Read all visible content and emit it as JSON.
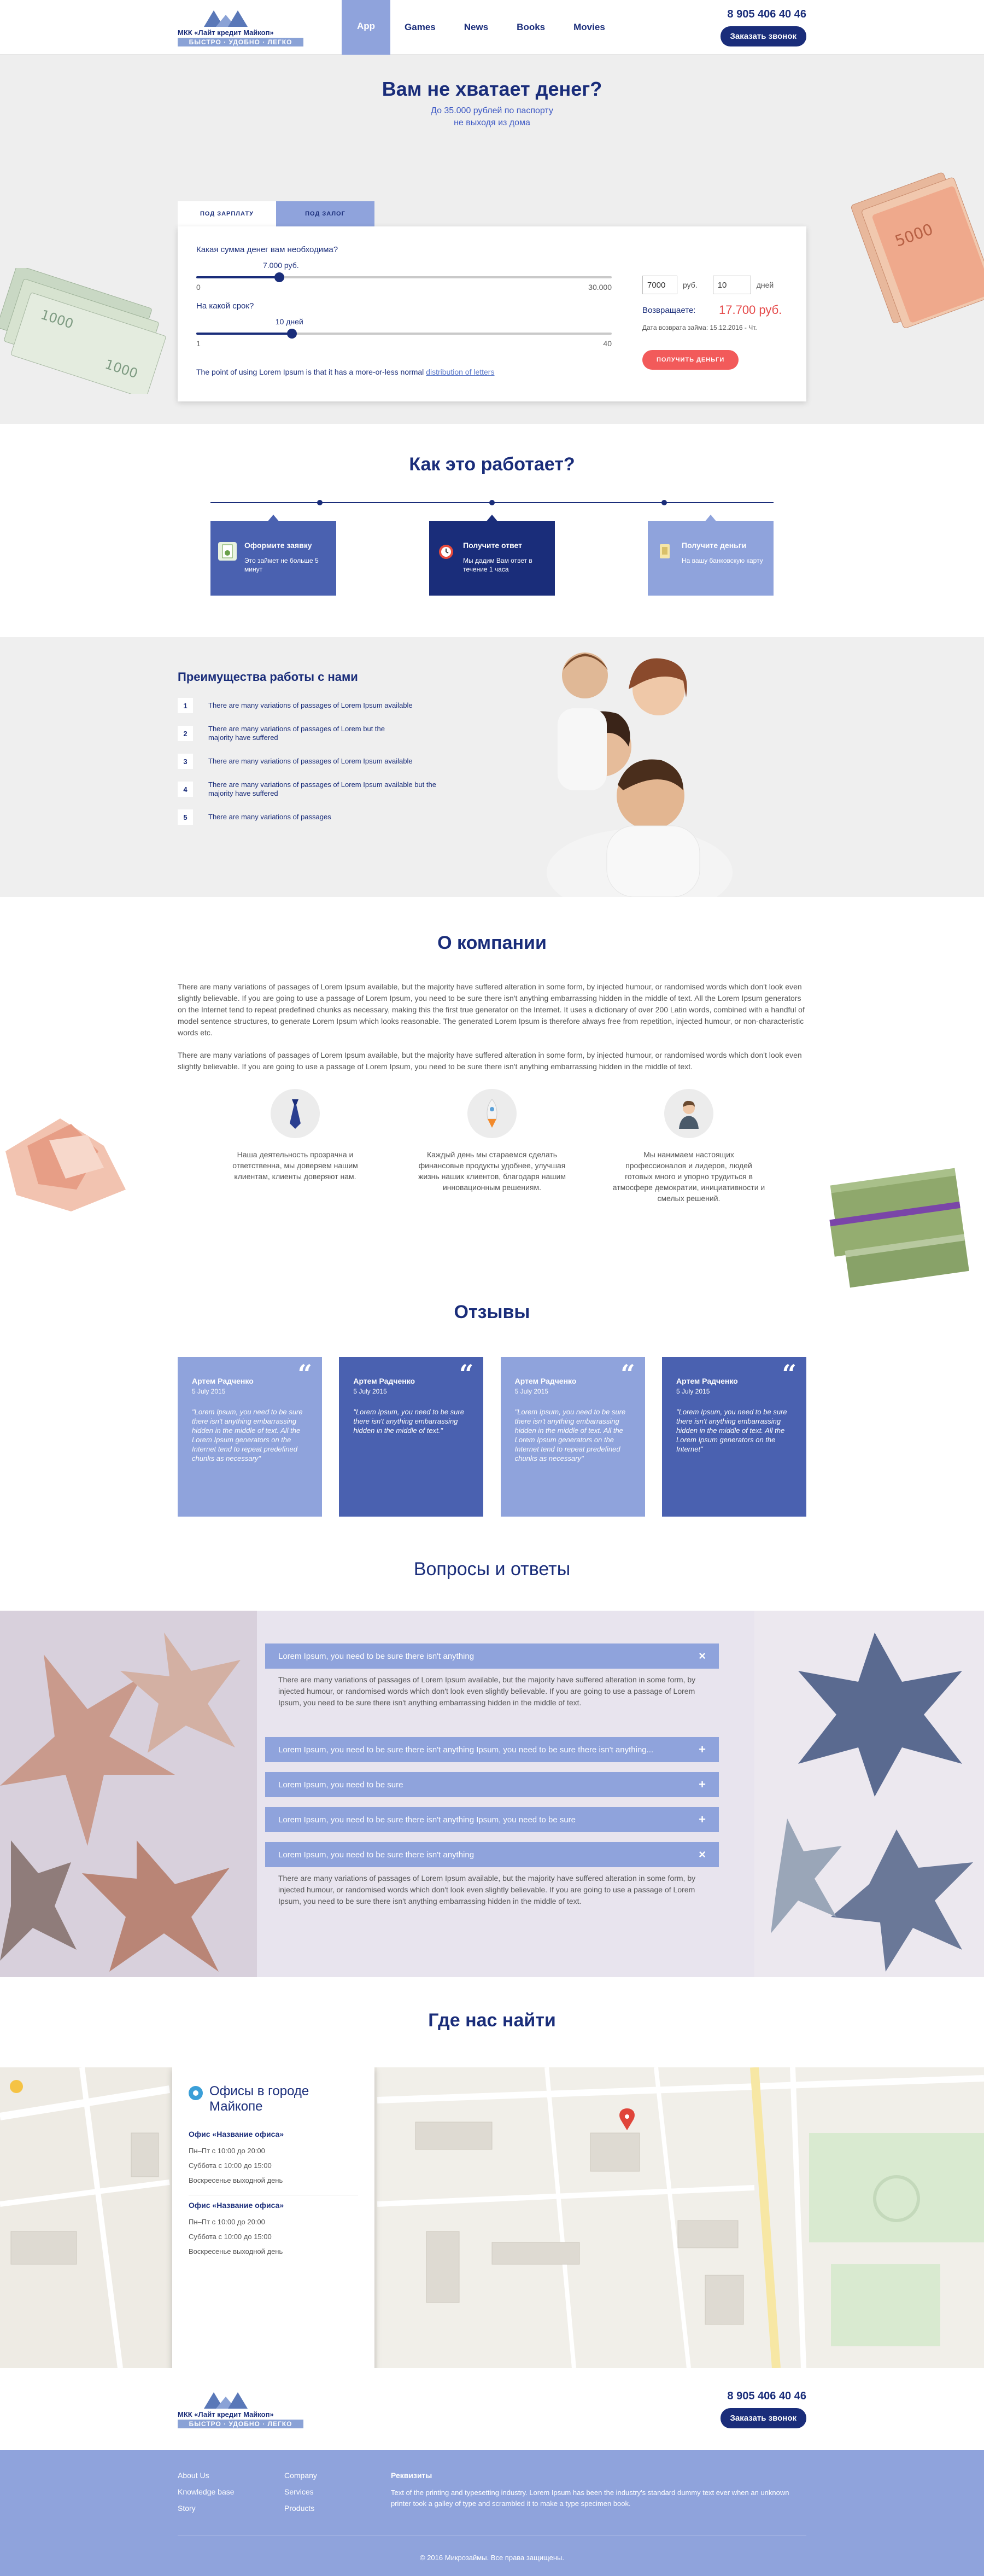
{
  "header": {
    "logo_name": "МКК «Лайт кредит Майкоп»",
    "logo_slogan": "БЫСТРО · УДОБНО · ЛЕГКО",
    "nav": [
      "App",
      "Games",
      "News",
      "Books",
      "Movies"
    ],
    "active_nav": "App",
    "phone": "8 905 406 40 46",
    "callback_button": "Заказать звонок"
  },
  "hero": {
    "title": "Вам не хватает денег?",
    "subtitle_1": "До 35.000 рублей по паспорту",
    "subtitle_2": "не выходя из дома",
    "tabs": [
      "ПОД ЗАРПЛАТУ",
      "ПОД ЗАЛОГ"
    ],
    "amount_question": "Какая сумма денег вам необходима?",
    "amount_value": "7.000 руб.",
    "amount_fraction": 0.2,
    "amount_min": "0",
    "amount_max": "30.000",
    "term_question": "На какой срок?",
    "term_value": "10 дней",
    "term_fraction": 0.23,
    "term_min": "1",
    "term_max": "40",
    "note_text": "The point of using Lorem Ipsum is that it has a more-or-less normal",
    "note_link": "distribution of letters",
    "amount_input": "7000",
    "amount_unit": "руб.",
    "term_input": "10",
    "term_unit": "дней",
    "return_label": "Возвращаете:",
    "return_value": "17.700 руб.",
    "return_date": "Дата возврата займа: 15.12.2016 - Чт.",
    "get_money_button": "ПОЛУЧИТЬ ДЕНЬГИ"
  },
  "how": {
    "title": "Как это работает?",
    "steps": [
      {
        "title": "Оформите заявку",
        "text": "Это займет не больше 5 минут"
      },
      {
        "title": "Получите ответ",
        "text": "Мы дадим Вам ответ в течение 1 часа"
      },
      {
        "title": "Получите деньги",
        "text": "На вашу банковскую карту"
      }
    ]
  },
  "advantages": {
    "title": "Преимущества работы с нами",
    "items": [
      {
        "num": "1",
        "text": "There are many variations of passages of Lorem Ipsum available"
      },
      {
        "num": "2",
        "text": "There are many variations of passages of Lorem but the majority have suffered"
      },
      {
        "num": "3",
        "text": "There are many variations of passages of Lorem Ipsum available"
      },
      {
        "num": "4",
        "text": "There are many variations of passages of Lorem Ipsum available but the majority have suffered"
      },
      {
        "num": "5",
        "text": "There are many variations of passages"
      }
    ]
  },
  "about": {
    "title": "О компании",
    "p1": "There are many variations of passages of Lorem Ipsum available, but the majority have suffered alteration in some form, by injected humour, or randomised words which don't look even slightly believable. If you are going to use a passage of Lorem Ipsum, you need to be sure there isn't anything embarrassing hidden in the middle of text. All the Lorem Ipsum generators on the Internet tend to repeat predefined chunks as necessary, making this the first true generator on the Internet. It uses a dictionary of over 200 Latin words, combined with a handful of model sentence structures, to generate Lorem Ipsum which looks reasonable. The generated Lorem Ipsum is therefore always free from repetition, injected humour, or non-characteristic words etc.",
    "p2": "There are many variations of passages of Lorem Ipsum available, but the majority have suffered alteration in some form, by injected humour, or randomised words which don't look even slightly believable. If you are going to use a passage of Lorem Ipsum, you need to be sure there isn't anything embarrassing hidden in the middle of text.",
    "features": [
      {
        "icon": "tie-icon",
        "text": "Наша деятельность прозрачна и ответственна, мы доверяем нашим клиентам, клиенты доверяют нам."
      },
      {
        "icon": "rocket-icon",
        "text": "Каждый день мы стараемся сделать финансовые продукты удобнее, улучшая жизнь наших клиентов, благодаря нашим инновационным решениям."
      },
      {
        "icon": "person-icon",
        "text": "Мы нанимаем настоящих профессионалов и лидеров, людей готовых много и упорно трудиться в атмосфере демократии, инициативности и смелых решений."
      }
    ]
  },
  "reviews": {
    "title": "Отзывы",
    "items": [
      {
        "name": "Артем Радченко",
        "date": "5 July 2015",
        "text": "\"Lorem Ipsum, you need to be sure there isn't anything embarrassing hidden in the middle of text. All the Lorem Ipsum generators on the Internet tend to repeat predefined chunks as necessary\""
      },
      {
        "name": "Артем Радченко",
        "date": "5 July 2015",
        "text": "\"Lorem Ipsum, you need to be sure there isn't anything embarrassing hidden in the middle of text.\""
      },
      {
        "name": "Артем Радченко",
        "date": "5 July 2015",
        "text": "\"Lorem Ipsum, you need to be sure there isn't anything embarrassing hidden in the middle of text. All the Lorem Ipsum generators on the Internet tend to repeat predefined chunks as necessary\""
      },
      {
        "name": "Артем Радченко",
        "date": "5 July 2015",
        "text": "\"Lorem Ipsum, you need to be sure there isn't anything embarrassing hidden in the middle of text. All the Lorem Ipsum generators on the Internet\""
      }
    ]
  },
  "faq": {
    "title": "Вопросы и ответы",
    "items": [
      {
        "q": "Lorem Ipsum, you need to be sure there isn't anything",
        "sign": "×",
        "a": "There are many variations of passages of Lorem Ipsum available, but the majority have suffered alteration in some form, by injected humour, or randomised words which don't look even slightly believable. If you are going to use a passage of Lorem Ipsum, you need to be sure there isn't anything embarrassing hidden in the middle of text."
      },
      {
        "q": "Lorem Ipsum, you need to be sure there isn't anything Ipsum, you need to be sure there isn't anything...",
        "sign": "+",
        "a": ""
      },
      {
        "q": "Lorem Ipsum, you need to be sure",
        "sign": "+",
        "a": ""
      },
      {
        "q": "Lorem Ipsum, you need to be sure there isn't anything Ipsum, you need to be sure",
        "sign": "+",
        "a": ""
      },
      {
        "q": "Lorem Ipsum, you need to be sure there isn't anything",
        "sign": "×",
        "a": "There are many variations of passages of Lorem Ipsum available, but the majority have suffered alteration in some form, by injected humour, or randomised words which don't look even slightly believable. If you are going to use a passage of Lorem Ipsum, you need to be sure there isn't anything embarrassing hidden in the middle of text."
      }
    ]
  },
  "contacts": {
    "title": "Где нас найти",
    "card_title": "Офисы в городе Майкопе",
    "offices": [
      {
        "name": "Офис «Название офиса»",
        "lines": [
          "Пн–Пт с 10:00 до 20:00",
          "Суббота с 10:00 до 15:00",
          "Воскресенье выходной день"
        ]
      },
      {
        "name": "Офис «Название офиса»",
        "lines": [
          "Пн–Пт с 10:00 до 20:00",
          "Суббота с 10:00 до 15:00",
          "Воскресенье выходной день"
        ]
      }
    ]
  },
  "footer": {
    "col1": [
      "About Us",
      "Knowledge base",
      "Story"
    ],
    "col2": [
      "Company",
      "Services",
      "Products"
    ],
    "req_title": "Реквизиты",
    "req_text": "Text of the printing and typesetting industry. Lorem Ipsum has been the industry's standard dummy text ever when an unknown printer took a galley of type and scrambled it to make a type specimen book.",
    "copyright": "© 2016 Микрозаймы. Все права защищены."
  },
  "colors": {
    "navy": "#1a2d7a",
    "accent_blue": "#8fa3dc",
    "mid_blue": "#4a61b0",
    "red": "#f25a5a"
  }
}
